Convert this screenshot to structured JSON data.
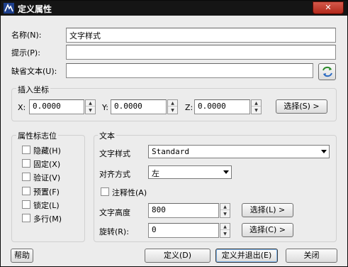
{
  "window": {
    "title": "定义属性",
    "close_glyph": "✕"
  },
  "attribute": {
    "name_label": "名称(N):",
    "name_value": "文字样式",
    "prompt_label": "提示(P):",
    "prompt_value": "",
    "default_label": "缺省文本(U):",
    "default_value": ""
  },
  "insert_point": {
    "group_label": "插入坐标",
    "x_label": "X:",
    "x_value": "0.0000",
    "y_label": "Y:",
    "y_value": "0.0000",
    "z_label": "Z:",
    "z_value": "0.0000",
    "pick_button": "选择(S) >"
  },
  "flags": {
    "group_label": "属性标志位",
    "items": [
      {
        "label": "隐藏(H)",
        "checked": false
      },
      {
        "label": "固定(X)",
        "checked": false
      },
      {
        "label": "验证(V)",
        "checked": false
      },
      {
        "label": "预置(F)",
        "checked": false
      },
      {
        "label": "锁定(L)",
        "checked": false
      },
      {
        "label": "多行(M)",
        "checked": false
      }
    ]
  },
  "text": {
    "group_label": "文本",
    "style_label": "文字样式",
    "style_value": "Standard",
    "justify_label": "对齐方式",
    "justify_value": "左",
    "annotative_label": "注释性(A)",
    "height_label": "文字高度",
    "height_value": "800",
    "height_pick": "选择(L) >",
    "rotation_label": "旋转(R):",
    "rotation_value": "0",
    "rotation_pick": "选择(C) >"
  },
  "footer": {
    "help": "帮助",
    "define": "定义(D)",
    "define_exit": "定义并退出(E)",
    "close": "关闭"
  },
  "colors": {
    "titlebar": "#151515",
    "dialog_bg": "#ececec",
    "close_button": "#c23a2d"
  }
}
